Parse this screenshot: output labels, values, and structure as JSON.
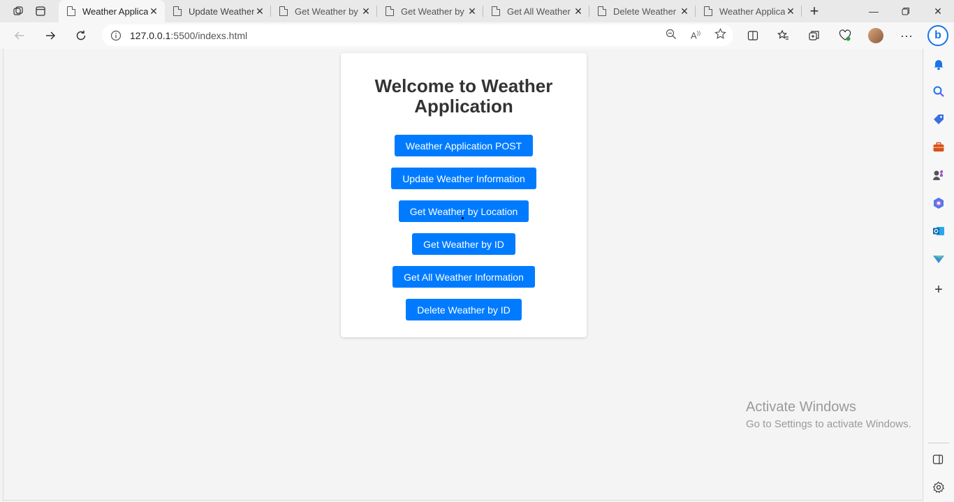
{
  "browser": {
    "tabs": [
      {
        "title": "Weather Applica",
        "active": true
      },
      {
        "title": "Update Weather",
        "active": false
      },
      {
        "title": "Get Weather by",
        "active": false
      },
      {
        "title": "Get Weather by",
        "active": false
      },
      {
        "title": "Get All Weather",
        "active": false
      },
      {
        "title": "Delete Weather",
        "active": false
      },
      {
        "title": "Weather Applica",
        "active": false
      }
    ],
    "address": {
      "host": "127.0.0.1",
      "path": ":5500/indexs.html"
    },
    "icons": {
      "workspaces": "workspaces-icon",
      "tab_actions": "tab-actions-icon",
      "back": "back-arrow-icon",
      "forward": "forward-arrow-icon",
      "refresh": "refresh-icon",
      "info": "info-icon",
      "zoom": "zoom-out-icon",
      "read_aloud": "read-aloud-icon",
      "favorite": "star-icon",
      "split": "split-screen-icon",
      "favorites": "favorites-icon",
      "collections": "collections-icon",
      "health": "browser-essentials-icon",
      "more": "more-icon",
      "bing": "bing-icon"
    }
  },
  "page": {
    "title": "Welcome to Weather Application",
    "buttons": [
      "Weather Application POST",
      "Update Weather Information",
      "Get Weather by Location",
      "Get Weather by ID",
      "Get All Weather Information",
      "Delete Weather by ID"
    ],
    "accent_color": "#007bff"
  },
  "watermark": {
    "line1": "Activate Windows",
    "line2": "Go to Settings to activate Windows."
  },
  "sidebar": {
    "items": [
      "bell-icon",
      "search-icon",
      "shopping-icon",
      "tools-icon",
      "games-icon",
      "copilot-icon",
      "outlook-icon",
      "drop-icon",
      "add-icon"
    ],
    "bottom": [
      "sidebar-toggle-icon",
      "settings-icon"
    ]
  }
}
